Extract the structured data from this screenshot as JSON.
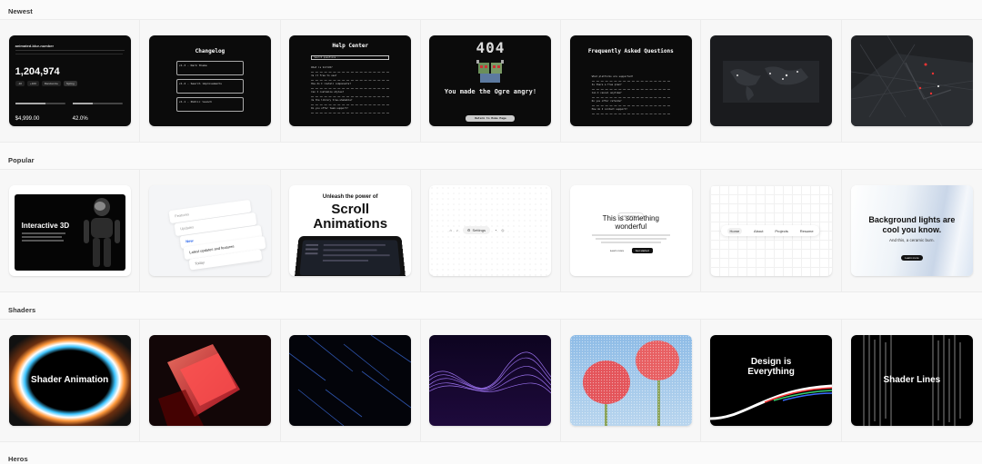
{
  "sections": {
    "newest": "Newest",
    "popular": "Popular",
    "shaders": "Shaders",
    "heros": "Heros"
  },
  "newest": {
    "counter": {
      "title": "animated-blur-number",
      "value": "1,204,974",
      "btn_a": "-10",
      "btn_b": "+100",
      "btn_c": "Randomize",
      "btn_d": "Spring",
      "stat1": "$4,999.00",
      "stat2": "42.0%"
    },
    "changelog": {
      "title": "Changelog",
      "entries": [
        "v1.3 - Dark theme",
        "v1.2 - Search improvements",
        "v1.1 - Public launch"
      ]
    },
    "help": {
      "title": "Help Center",
      "search": "Search questions...",
      "items": [
        "What is VoltUI?",
        "Is it free to use?",
        "How do I install components?",
        "Can I customize styles?",
        "Is the library tree-shakable?",
        "Do you offer team support?"
      ]
    },
    "notfound": {
      "code": "404",
      "title": "You made the Ogre angry!",
      "button": "Return to Home Page"
    },
    "faq": {
      "title": "Frequently Asked Questions",
      "items": [
        "What platforms are supported?",
        "Is there a free plan?",
        "Can I cancel anytime?",
        "Do you offer refunds?",
        "How do I contact support?"
      ]
    }
  },
  "popular": {
    "interactive": {
      "title": "Interactive 3D"
    },
    "notifications": {
      "items": [
        "Features",
        "Updates",
        "New",
        "Latest updates and features",
        "Today"
      ]
    },
    "scroll": {
      "line1": "Unleash the power of",
      "line2": "Scroll",
      "line3": "Animations"
    },
    "toolbar": {
      "label": "Settings"
    },
    "wonderful": {
      "badge": "Introducing v2",
      "line1": "This is something",
      "line2": "wonderful",
      "btn1": "Learn more",
      "btn2": "Get started"
    },
    "nav": {
      "items": [
        "Home",
        "About",
        "Projects",
        "Resume"
      ]
    },
    "lights": {
      "line1": "Background lights are",
      "line2": "cool you know.",
      "sub": "And this, a ceramic burn.",
      "btn": "Learn more"
    }
  },
  "shaders": {
    "anim": {
      "label": "Shader Animation"
    },
    "design": {
      "line1": "Design is",
      "line2": "Everything"
    },
    "lines": {
      "label": "Shader Lines"
    }
  },
  "colors": {
    "accent_blue": "#2563eb",
    "shader_red": "#ff4a4a",
    "wave_purple": "#8b5cf6"
  }
}
